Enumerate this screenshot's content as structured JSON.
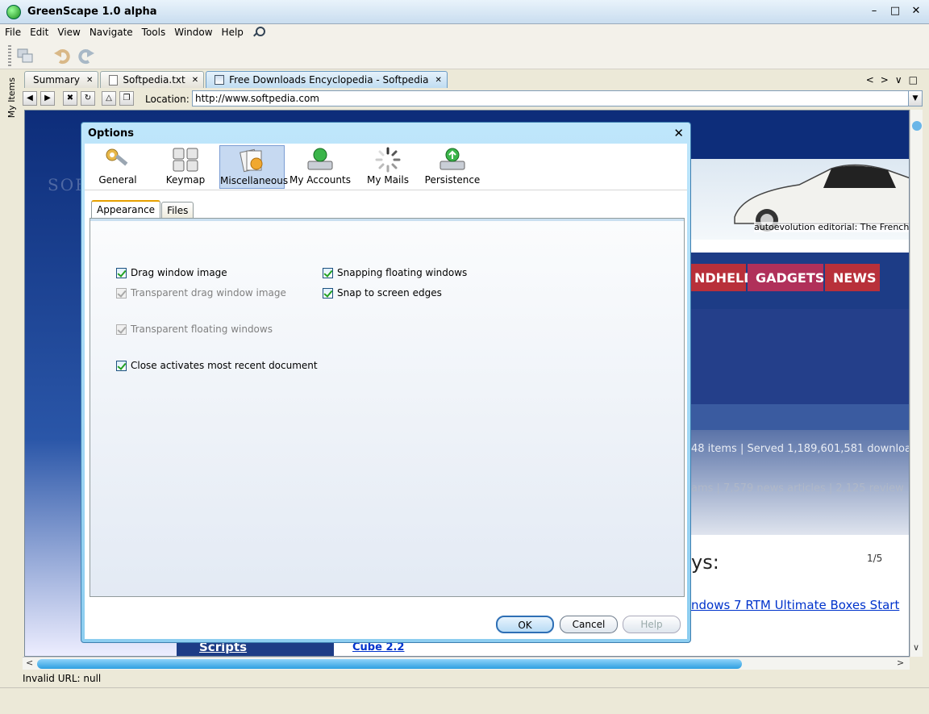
{
  "window": {
    "title": "GreenScape 1.0 alpha"
  },
  "menu": [
    "File",
    "Edit",
    "View",
    "Navigate",
    "Tools",
    "Window",
    "Help"
  ],
  "side_label": "My Items",
  "tabs": [
    {
      "label": "Summary",
      "active": false
    },
    {
      "label": "Softpedia.txt",
      "active": false
    },
    {
      "label": "Free Downloads Encyclopedia - Softpedia",
      "active": true
    }
  ],
  "location": {
    "label": "Location:",
    "value": "http://www.softpedia.com"
  },
  "status": {
    "text": "Invalid URL: null"
  },
  "browser_page": {
    "watermark": "SOFTPEDIA",
    "car_caption": "autoevolution editorial: The French Con",
    "nav_tabs": [
      "NDHELD",
      "GADGETS",
      "NEWS"
    ],
    "stats_line1": "48 items | Served 1,189,601,581 downloa",
    "stats_line2": "ams | 7,579 news articles | 2,125 review",
    "page_counter": "1/5",
    "big_text": "ys:",
    "link_text": "ndows 7 RTM Ultimate Boxes Start",
    "scripts_label": "Scripts",
    "cube_link": "Cube 2.2"
  },
  "dialog": {
    "title": "Options",
    "categories": [
      {
        "label": "General",
        "icon": "wrench-gear-icon",
        "active": false
      },
      {
        "label": "Keymap",
        "icon": "keyboard-icon",
        "active": false
      },
      {
        "label": "Miscellaneous",
        "icon": "misc-cards-icon",
        "active": true
      },
      {
        "label": "My Accounts",
        "icon": "accounts-drive-icon",
        "active": false
      },
      {
        "label": "My Mails",
        "icon": "spinner-icon",
        "active": false
      },
      {
        "label": "Persistence",
        "icon": "persistence-drive-icon",
        "active": false
      }
    ],
    "subtabs": [
      {
        "label": "Appearance",
        "active": true
      },
      {
        "label": "Files",
        "active": false
      }
    ],
    "options": {
      "drag_window_image": {
        "label": "Drag window image",
        "checked": true,
        "enabled": true
      },
      "transparent_drag_window_image": {
        "label": "Transparent drag window image",
        "checked": true,
        "enabled": false
      },
      "transparent_floating_windows": {
        "label": "Transparent floating windows",
        "checked": true,
        "enabled": false
      },
      "close_activates_recent": {
        "label": "Close activates most recent document",
        "checked": true,
        "enabled": true
      },
      "snapping_floating_windows": {
        "label": "Snapping floating windows",
        "checked": true,
        "enabled": true
      },
      "snap_to_screen_edges": {
        "label": "Snap to screen edges",
        "checked": true,
        "enabled": true
      }
    },
    "buttons": {
      "ok": "OK",
      "cancel": "Cancel",
      "help": "Help"
    }
  },
  "colors": {
    "accent": "#2e9fe0",
    "page_bg": "#0d2d7a",
    "nav_red": "#b8303a"
  }
}
